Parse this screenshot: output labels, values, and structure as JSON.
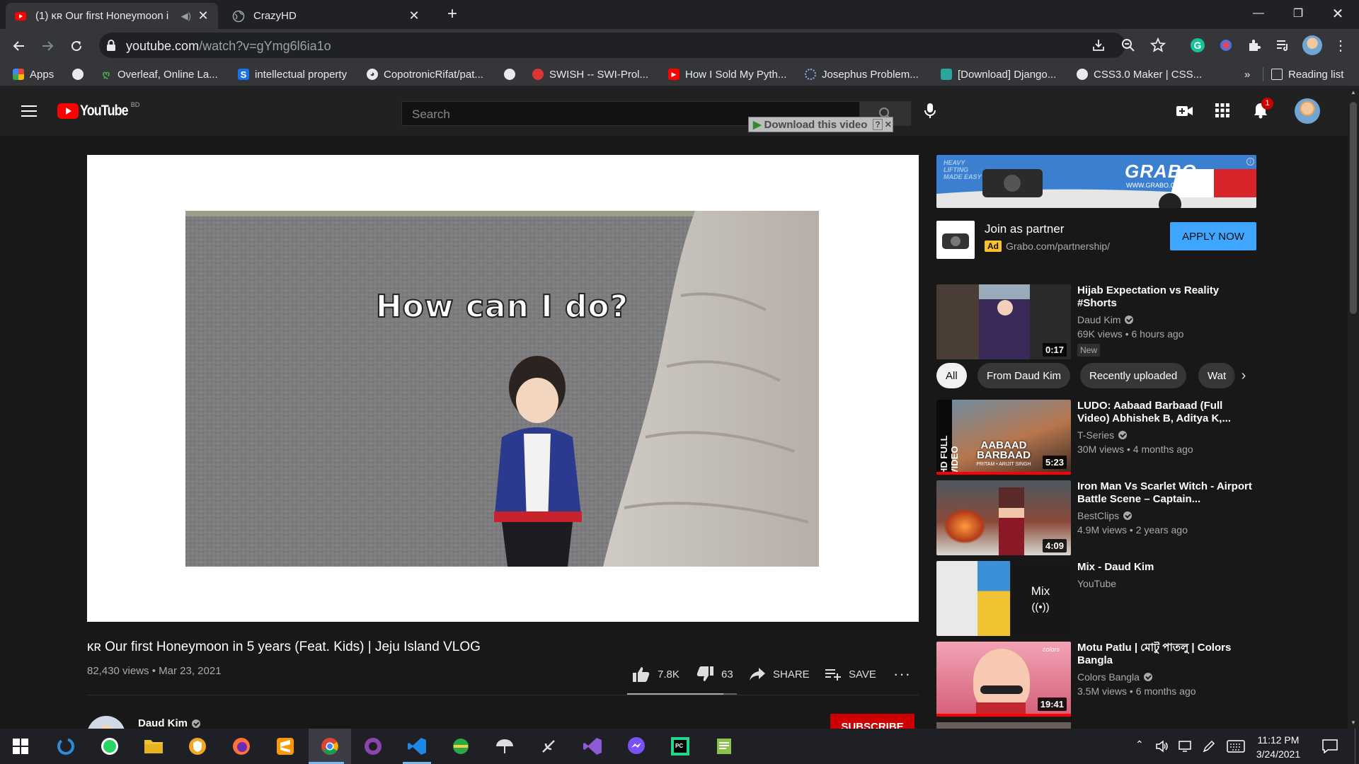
{
  "browser": {
    "tabs": [
      {
        "title": "(1) ᴋʀ Our first Honeymoon i",
        "active": true
      },
      {
        "title": "CrazyHD",
        "active": false
      }
    ],
    "url_domain": "youtube.com",
    "url_path": "/watch?v=gYmg6l6ia1o",
    "bookmarks": [
      {
        "label": "Apps",
        "icon": "apps-grid-icon"
      },
      {
        "label": "",
        "icon": "globe-icon"
      },
      {
        "label": "Overleaf, Online La...",
        "icon": "overleaf-icon"
      },
      {
        "label": "intellectual property",
        "icon": "s-icon"
      },
      {
        "label": "CopotronicRifat/pat...",
        "icon": "github-icon"
      },
      {
        "label": "",
        "icon": "globe-icon"
      },
      {
        "label": "SWISH -- SWI-Prol...",
        "icon": "swish-icon"
      },
      {
        "label": "How I Sold My Pyth...",
        "icon": "youtube-icon"
      },
      {
        "label": "Josephus Problem...",
        "icon": "spinner-icon"
      },
      {
        "label": "[Download] Django...",
        "icon": "image-icon"
      },
      {
        "label": "CSS3.0 Maker | CSS...",
        "icon": "globe-icon"
      }
    ],
    "bookmarks_overflow": "»",
    "reading_list": "Reading list"
  },
  "youtube": {
    "logo": "YouTube",
    "country": "BD",
    "search_placeholder": "Search",
    "download_bar": "Download this video",
    "notification_count": "1",
    "video_caption": "How can I do?",
    "video_title": "ᴋʀ Our first Honeymoon in 5 years (Feat. Kids) | Jeju Island VLOG",
    "views": "82,430 views",
    "date": "Mar 23, 2021",
    "likes": "7.8K",
    "dislikes": "63",
    "like_ratio": 0.88,
    "share": "SHARE",
    "save": "SAVE",
    "channel": "Daud Kim",
    "subscribe": "SUBSCRIBE"
  },
  "ad": {
    "banner_brand": "GRABO",
    "banner_slogan": "HEAVY LIFTING MADE EASY",
    "banner_url": "WWW.GRABO.COM",
    "title": "Join as partner",
    "badge": "Ad",
    "url": "Grabo.com/partnership/",
    "cta": "APPLY NOW"
  },
  "chips": [
    "All",
    "From Daud Kim",
    "Recently uploaded",
    "Wat"
  ],
  "recommendations": [
    {
      "title": "Hijab Expectation vs Reality #Shorts",
      "channel": "Daud Kim",
      "verified": true,
      "meta": "69K views • 6 hours ago",
      "badge": "New",
      "duration": "0:17"
    },
    {
      "title": "LUDO: Aabaad Barbaad (Full Video) Abhishek B, Aditya K,...",
      "channel": "T-Series",
      "verified": true,
      "meta": "30M views • 4 months ago",
      "duration": "5:23",
      "thumb_text": "HD FULL VIDEO",
      "thumb_text2": "AABAAD BARBAAD",
      "thumb_text3": "PRITAM • ARIJIT SINGH"
    },
    {
      "title": "Iron Man Vs Scarlet Witch - Airport Battle Scene – Captain...",
      "channel": "BestClips",
      "verified": true,
      "meta": "4.9M views • 2 years ago",
      "duration": "4:09"
    },
    {
      "title": "Mix - Daud Kim",
      "channel": "YouTube",
      "verified": false,
      "meta": "",
      "duration": "",
      "mix_label": "Mix"
    },
    {
      "title": "Motu Patlu | মোটু পাতলু | Colors Bangla",
      "channel": "Colors Bangla",
      "verified": true,
      "meta": "3.5M views • 6 months ago",
      "duration": "19:41",
      "thumb_text": "colors"
    }
  ],
  "taskbar": {
    "time": "11:12 PM",
    "date": "3/24/2021"
  }
}
